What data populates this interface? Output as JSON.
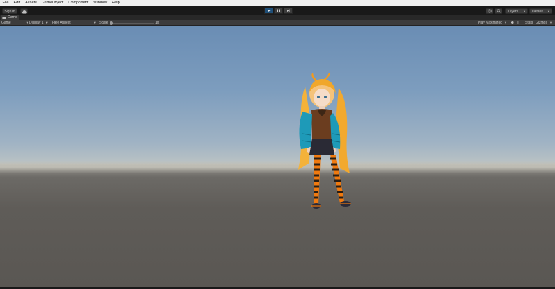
{
  "menu": [
    "File",
    "Edit",
    "Assets",
    "GameObject",
    "Component",
    "Window",
    "Help"
  ],
  "toolbar": {
    "sign_in": "Sign in",
    "layers": "Layers",
    "layout": "Default",
    "play_mode": "playing"
  },
  "game_tab": {
    "label": "Game"
  },
  "game_bar": {
    "view": "Game",
    "display": "Display 1",
    "aspect": "Free Aspect",
    "scale_label": "Scale",
    "scale_value": "1x",
    "play_maximized": "Play Maximized",
    "stats": "Stats",
    "gizmos": "Gizmos"
  },
  "colors": {
    "sky_top": "#6a8db4",
    "ground": "#5f5c58",
    "editor_dark": "#191919",
    "play_active": "#1f4f78"
  },
  "icons": [
    "cloud-icon",
    "play-icon",
    "pause-icon",
    "step-icon",
    "history-icon",
    "search-icon",
    "menu-icon",
    "audio-icon",
    "chevron-down-icon"
  ]
}
